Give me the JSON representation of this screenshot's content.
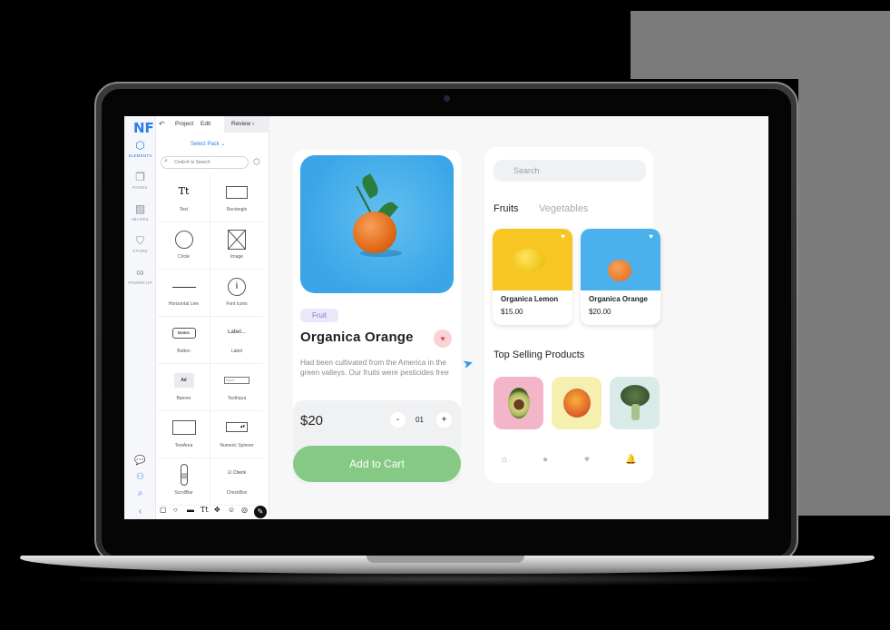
{
  "editor": {
    "logo": "NF",
    "rail": [
      {
        "icon": "cube-icon",
        "glyph": "⬡",
        "label": "ELEMENTS"
      },
      {
        "icon": "pages-icon",
        "glyph": "❐",
        "label": "PAGES"
      },
      {
        "icon": "images-icon",
        "glyph": "▨",
        "label": "IMAGES"
      },
      {
        "icon": "store-icon",
        "glyph": "⛉",
        "label": "STORE"
      },
      {
        "icon": "power-up-icon",
        "glyph": "∞",
        "label": "POWER-UP"
      }
    ],
    "topbar": {
      "undo": "↶",
      "project": "Project",
      "edit": "Edit",
      "review": "Review ›"
    },
    "select_pack": "Select Pack  ⌄",
    "search_placeholder": "Cmd+K to Search",
    "components": [
      {
        "label": "Text"
      },
      {
        "label": "Rectangle"
      },
      {
        "label": "Circle"
      },
      {
        "label": "Image"
      },
      {
        "label": "Horizontal Line"
      },
      {
        "label": "Font Icons"
      },
      {
        "label": "Button",
        "inner": "Button"
      },
      {
        "label": "Label",
        "inner": "Label..."
      },
      {
        "label": "Banner",
        "inner": "Ad"
      },
      {
        "label": "TextInput",
        "inner": "Input"
      },
      {
        "label": "TextArea"
      },
      {
        "label": "Numeric Spinner"
      },
      {
        "label": "ScrollBar"
      },
      {
        "label": "CheckBox",
        "inner": "Check"
      }
    ],
    "text_glyph": "Tt",
    "info_glyph": "i"
  },
  "product": {
    "tag": "Fruit",
    "name": "Organica Orange",
    "description": "Had been cultivated from the America in the green valleys. Our fruits were pesticides free",
    "price": "$20",
    "minus": "-",
    "qty": "01",
    "plus": "+",
    "cta": "Add to Cart"
  },
  "store": {
    "search_placeholder": "Search",
    "tabs": [
      "Fruits",
      "Vegetables"
    ],
    "cards": [
      {
        "name": "Organica Lemon",
        "price": "$15.00"
      },
      {
        "name": "Organica Orange",
        "price": "$20.00"
      }
    ],
    "section_title": "Top Selling Products"
  },
  "colors": {
    "accent": "#2f7ee8",
    "cta_green": "#86c985",
    "heart": "#e04e55"
  }
}
